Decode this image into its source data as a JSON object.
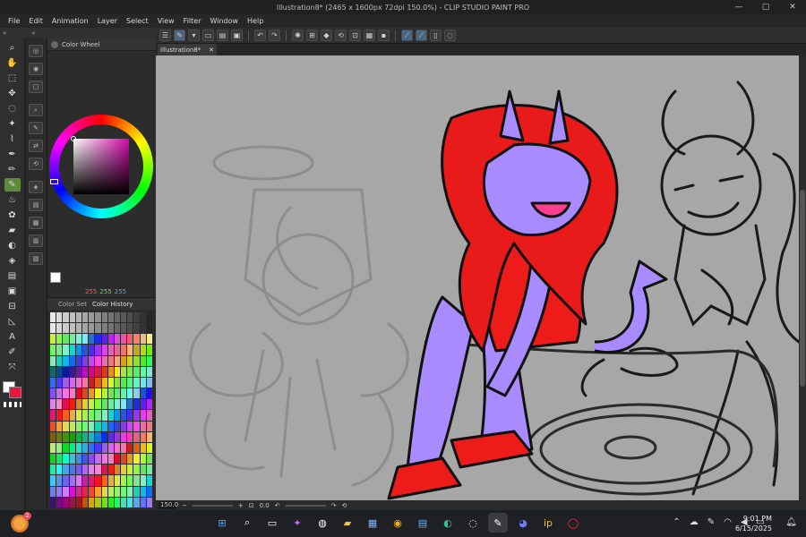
{
  "window": {
    "title": "Illustration8* (2465 x 1600px 72dpi 150.0%) - CLIP STUDIO PAINT PRO",
    "minimize": "—",
    "maximize": "▢",
    "close": "✕"
  },
  "menu": [
    "File",
    "Edit",
    "Animation",
    "Layer",
    "Select",
    "View",
    "Filter",
    "Window",
    "Help"
  ],
  "left_strip": {
    "collapse_left": "«",
    "collapse_right": "«"
  },
  "color_panel": {
    "tab_label": "Color Wheel",
    "rgb_r": "255",
    "rgb_g": "255",
    "rgb_b": "255"
  },
  "color_set": {
    "tab_inactive": "Color Set",
    "tab_active": "Color History"
  },
  "document": {
    "tab_label": "Illustration8*",
    "close_label": "✕"
  },
  "status": {
    "zoom": "150.0",
    "angle": "0.0"
  },
  "taskbar": {
    "widget_badge": "2",
    "clock_time": "9:01 PM",
    "clock_date": "6/15/2025"
  },
  "colors": {
    "accent_active_tool": "#5f8a3a",
    "foreground": "#ffffff",
    "background": "#e8173d",
    "canvas_bg": "#a7a7a7"
  },
  "icons": {
    "tools": [
      "pen-icon",
      "zoom-icon",
      "hand-icon",
      "rotate-icon",
      "move-icon",
      "lasso-icon",
      "wand-icon",
      "eyedropper-icon",
      "pen-icon",
      "pencil-icon",
      "brush-icon",
      "airbrush-icon",
      "eraser-icon",
      "blend-icon",
      "fill-icon",
      "gradient-icon",
      "figure-icon",
      "frame-icon",
      "ruler-icon",
      "text-icon",
      "balloon-icon",
      "correction-icon"
    ]
  }
}
